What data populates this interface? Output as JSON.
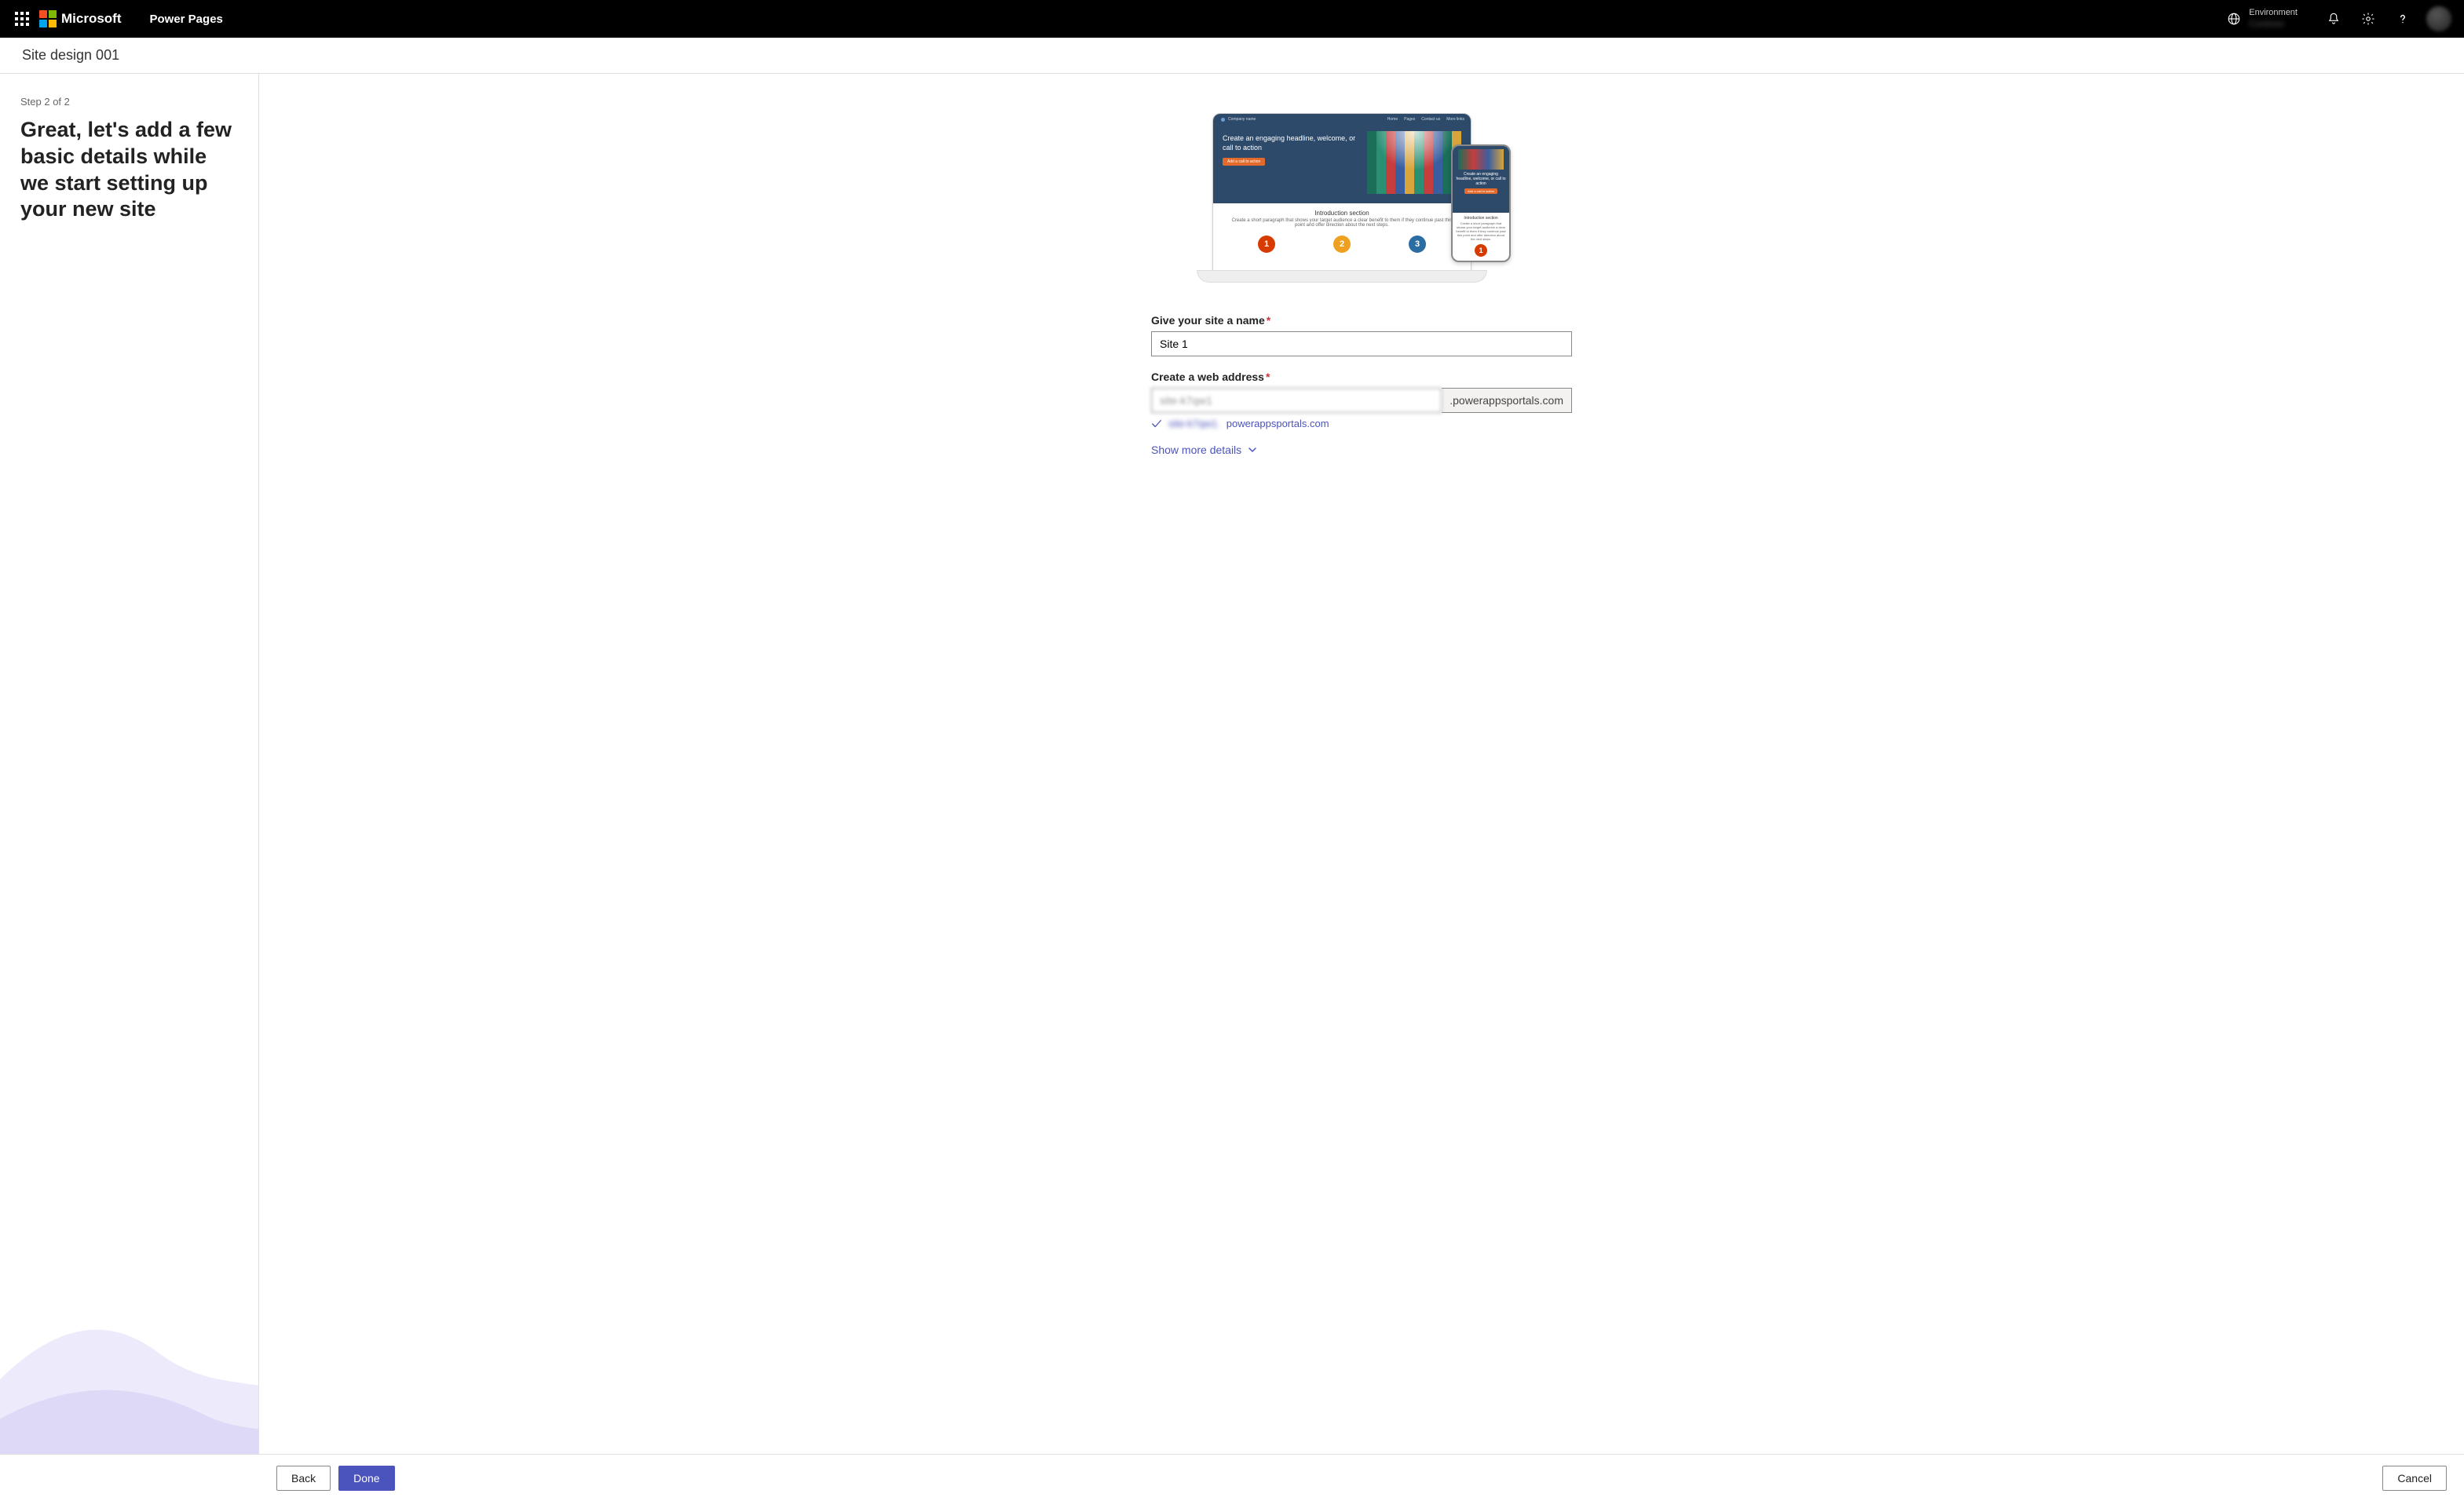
{
  "header": {
    "microsoft": "Microsoft",
    "product": "Power Pages",
    "env_label": "Environment",
    "env_value": "Contoso"
  },
  "subheader": {
    "site_design_title": "Site design 001"
  },
  "left": {
    "step": "Step 2 of 2",
    "title": "Great, let's add a few basic details while we start setting up your new site"
  },
  "preview": {
    "company": "Company name",
    "nav": {
      "home": "Home",
      "pages": "Pages",
      "contact": "Contact us",
      "more": "More links"
    },
    "hero_headline": "Create an engaging headline, welcome, or call to action",
    "hero_cta": "Add a call to action",
    "intro_title": "Introduction section",
    "intro_body": "Create a short paragraph that shows your target audience a clear benefit to them if they continue past this point and offer direction about the next steps.",
    "phone_headline": "Create an engaging headline, welcome, or call to action",
    "phone_intro_title": "Introduction section"
  },
  "form": {
    "site_name_label": "Give your site a name",
    "site_name_value": "Site 1",
    "web_addr_label": "Create a web address",
    "web_addr_value": "site-k7qw1",
    "web_addr_suffix": ".powerappsportals.com",
    "validated_prefix": "site-k7qw1.",
    "validated_domain": "powerappsportals.com",
    "show_more": "Show more details"
  },
  "footer": {
    "back": "Back",
    "done": "Done",
    "cancel": "Cancel"
  }
}
